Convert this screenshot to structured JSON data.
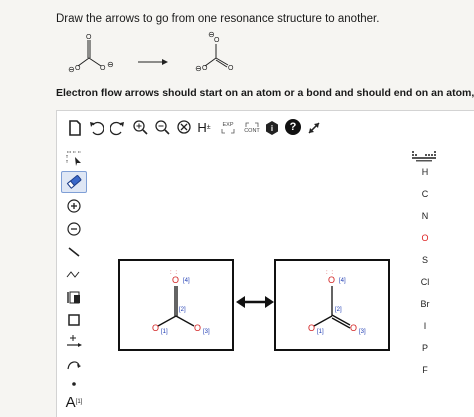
{
  "question": {
    "prompt": "Draw the arrows to go from one resonance structure to another.",
    "instruction": "Electron flow arrows should start on an atom or a bond and should end on an atom, bond, o"
  },
  "reaction": {
    "charge_symbol": "⊖"
  },
  "toolbar": {
    "exp_label": "EXP",
    "cont_label": "CONT",
    "h_label": "H",
    "h_superscript": "±",
    "info_label": "i",
    "help_label": "?"
  },
  "left_tools": {
    "atom_label": "A",
    "atom_superscript": "[1]"
  },
  "elements": [
    "H",
    "C",
    "N",
    "O",
    "S",
    "Cl",
    "Br",
    "I",
    "P",
    "F"
  ],
  "structures": {
    "left": {
      "top_o": "O",
      "left_o": "O",
      "right_o": "O",
      "labels": [
        "[4]",
        "[2]",
        "[1]",
        "[3]"
      ]
    },
    "right": {
      "top_o": "O",
      "left_o": "O",
      "right_o": "O",
      "labels": [
        "[4]",
        "[2]",
        "[1]",
        "[3]"
      ]
    }
  },
  "colors": {
    "oxygen": "#d22222",
    "label_blue": "#1d3bb3",
    "selection": "#dfe7f5"
  }
}
